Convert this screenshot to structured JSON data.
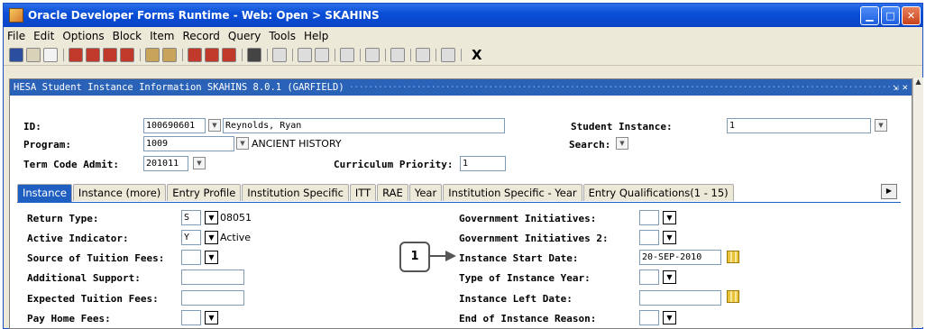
{
  "window": {
    "title": "Oracle Developer Forms Runtime - Web:  Open > SKAHINS"
  },
  "menu": [
    "File",
    "Edit",
    "Options",
    "Block",
    "Item",
    "Record",
    "Query",
    "Tools",
    "Help"
  ],
  "toolbar": {
    "exit_label": "X"
  },
  "form": {
    "title": "HESA Student Instance Information  SKAHINS 8.0.1  (GARFIELD)",
    "header": {
      "id_label": "ID:",
      "id_value": "100690601",
      "name_value": "Reynolds, Ryan",
      "program_label": "Program:",
      "program_value": "1009",
      "program_desc": "ANCIENT HISTORY",
      "term_label": "Term Code Admit:",
      "term_value": "201011",
      "curriculum_label": "Curriculum Priority:",
      "curriculum_value": "1",
      "student_instance_label": "Student Instance:",
      "student_instance_value": "1",
      "search_label": "Search:"
    },
    "tabs": [
      "Instance",
      "Instance (more)",
      "Entry Profile",
      "Institution Specific",
      "ITT",
      "RAE",
      "Year",
      "Institution Specific - Year",
      "Entry Qualifications(1 - 15)"
    ],
    "left_fields": {
      "return_type_label": "Return Type:",
      "return_type_value": "S",
      "return_type_desc": "08051",
      "active_label": "Active Indicator:",
      "active_value": "Y",
      "active_desc": "Active",
      "tuition_label": "Source of Tuition Fees:",
      "support_label": "Additional Support:",
      "expected_label": "Expected Tuition Fees:",
      "home_label": "Pay Home Fees:"
    },
    "right_fields": {
      "gov1_label": "Government Initiatives:",
      "gov2_label": "Government Initiatives 2:",
      "start_label": "Instance Start Date:",
      "start_value": "20-SEP-2010",
      "type_label": "Type of Instance Year:",
      "left_label": "Instance Left Date:",
      "end_label": "End of Instance Reason:"
    }
  },
  "callout": {
    "number": "1"
  }
}
